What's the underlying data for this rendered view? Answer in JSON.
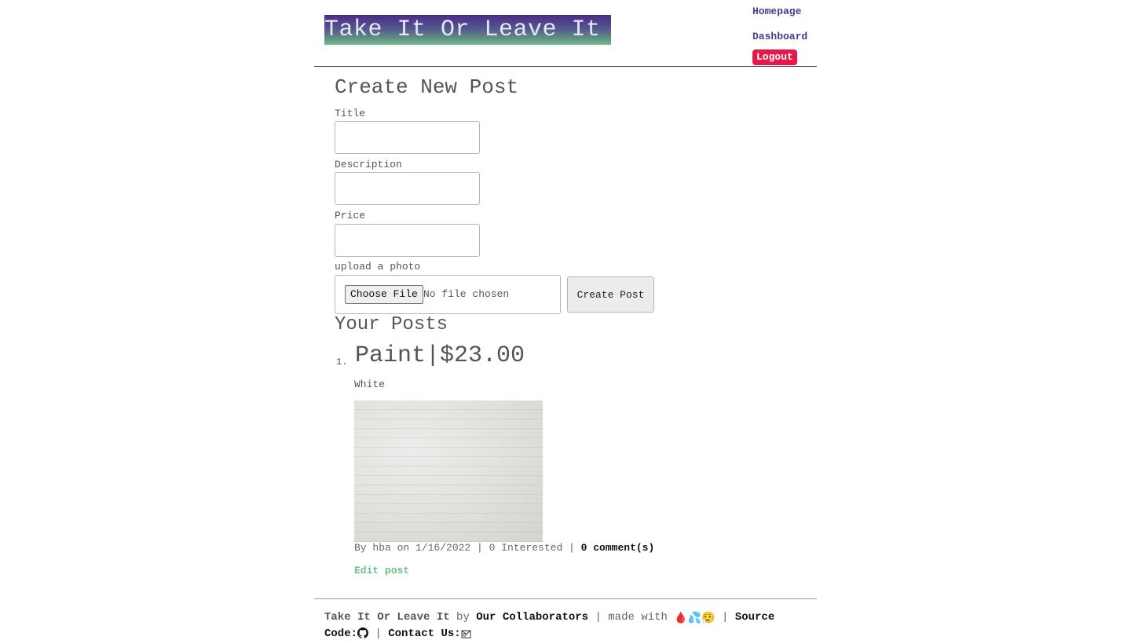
{
  "header": {
    "brand": "Take It Or Leave It",
    "nav": {
      "homepage": "Homepage",
      "dashboard": "Dashboard",
      "logout": "Logout"
    }
  },
  "form": {
    "heading": "Create New Post",
    "title_label": "Title",
    "title_value": "",
    "description_label": "Description",
    "description_value": "",
    "price_label": "Price",
    "price_value": "",
    "photo_label": "upload a photo",
    "choose_file_label": "Choose File",
    "file_status": "No file chosen",
    "submit_label": "Create Post"
  },
  "posts": {
    "heading": "Your Posts",
    "items": [
      {
        "number": "1.",
        "title": "Paint|$23.00",
        "description": "White",
        "meta": "By hba on 1/16/2022 | 0 Interested | ",
        "comments": "0 comment(s)",
        "edit_label": "Edit post"
      }
    ]
  },
  "footer": {
    "brand": "Take It Or Leave It",
    "by": " by ",
    "collaborators": "Our Collaborators",
    "made_with": " | made with ",
    "emojis": "🩸💦😮‍💨",
    "sep1": " | ",
    "source_code": "Source",
    "source_code2": "Code:",
    "sep2": " | ",
    "contact": "Contact Us:"
  },
  "colors": {
    "nav_link": "#4c3a8f",
    "logout_bg": "#e8174a",
    "edit_link": "#6dbf8a"
  },
  "icons": {
    "github": "github-icon",
    "mail": "mail-icon"
  }
}
